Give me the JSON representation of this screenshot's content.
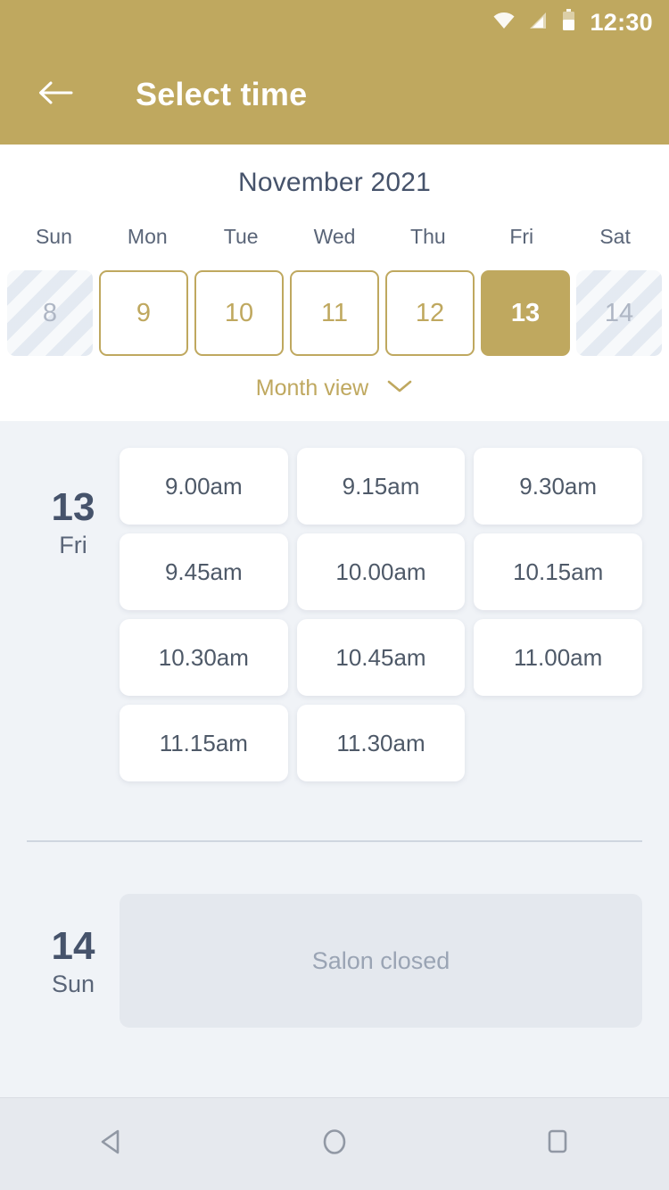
{
  "statusbar": {
    "time": "12:30",
    "icons": [
      "wifi-icon",
      "signal-icon",
      "battery-icon"
    ]
  },
  "appbar": {
    "title": "Select time",
    "back_icon": "arrow-left-icon"
  },
  "calendar": {
    "month_label": "November 2021",
    "weekdays": [
      "Sun",
      "Mon",
      "Tue",
      "Wed",
      "Thu",
      "Fri",
      "Sat"
    ],
    "dates": [
      {
        "day": "8",
        "state": "disabled"
      },
      {
        "day": "9",
        "state": "available"
      },
      {
        "day": "10",
        "state": "available"
      },
      {
        "day": "11",
        "state": "available"
      },
      {
        "day": "12",
        "state": "available"
      },
      {
        "day": "13",
        "state": "selected"
      },
      {
        "day": "14",
        "state": "disabled"
      }
    ],
    "month_view_label": "Month view",
    "month_view_icon": "chevron-down-icon"
  },
  "days": [
    {
      "day_number": "13",
      "day_of_week": "Fri",
      "slots": [
        "9.00am",
        "9.15am",
        "9.30am",
        "9.45am",
        "10.00am",
        "10.15am",
        "10.30am",
        "10.45am",
        "11.00am",
        "11.15am",
        "11.30am"
      ]
    },
    {
      "day_number": "14",
      "day_of_week": "Sun",
      "closed_label": "Salon closed"
    }
  ],
  "navbar": {
    "back": "nav-back-icon",
    "home": "nav-home-icon",
    "recents": "nav-recents-icon"
  },
  "colors": {
    "brand_gold": "#BFA85F",
    "slate": "#46536B",
    "page_bg": "#F0F3F7",
    "closed_bg": "#E4E8EE"
  }
}
